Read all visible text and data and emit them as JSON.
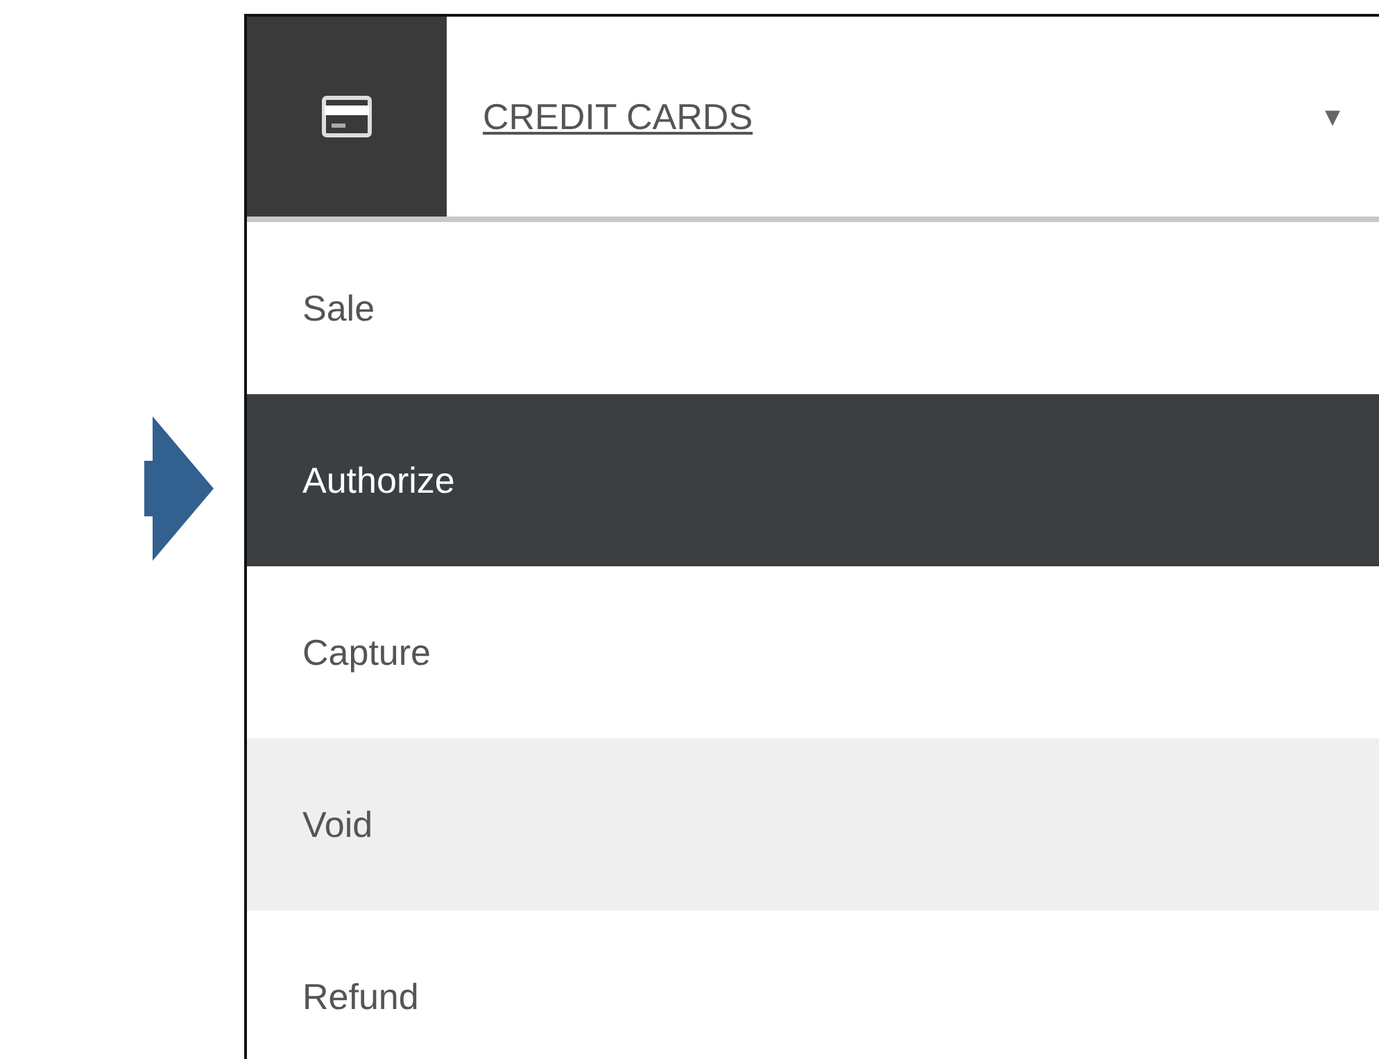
{
  "header": {
    "title": "CREDIT CARDS",
    "caret": "▾"
  },
  "items": [
    {
      "label": "Sale",
      "selected": false,
      "highlighted": false
    },
    {
      "label": "Authorize",
      "selected": true,
      "highlighted": false
    },
    {
      "label": "Capture",
      "selected": false,
      "highlighted": false
    },
    {
      "label": "Void",
      "selected": false,
      "highlighted": true
    },
    {
      "label": "Refund",
      "selected": false,
      "highlighted": false
    }
  ]
}
